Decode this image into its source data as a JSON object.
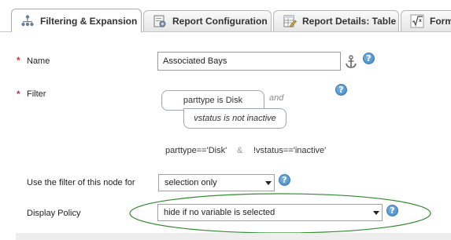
{
  "tabs": [
    {
      "label": "Filtering & Expansion",
      "icon": "hierarchy-icon",
      "active": true
    },
    {
      "label": "Report Configuration",
      "icon": "settings-icon",
      "active": false
    },
    {
      "label": "Report Details: Table",
      "icon": "table-edit-icon",
      "active": false
    },
    {
      "label": "Form",
      "icon": "formula-icon",
      "active": false
    }
  ],
  "form": {
    "required_marker": "*",
    "name": {
      "label": "Name",
      "value": "Associated Bays"
    },
    "filter": {
      "label": "Filter",
      "conjunction": "and",
      "term1": "parttype is Disk",
      "term2": "vstatus is not inactive",
      "expression_part1": "parttype=='Disk'",
      "expression_and": "&",
      "expression_part2": "!vstatus=='inactive'"
    },
    "use_filter": {
      "label": "Use the filter of this node for",
      "value": "selection only"
    },
    "display_policy": {
      "label": "Display Policy",
      "value": "hide if no variable is selected"
    },
    "help_glyph": "?"
  },
  "colors": {
    "required": "#c0392b",
    "highlight_ellipse": "#2e8b2e",
    "help": "#3f85c7"
  }
}
